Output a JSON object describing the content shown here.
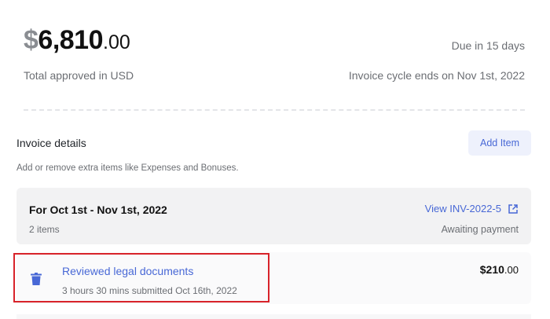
{
  "summary": {
    "currency_symbol": "$",
    "amount_main": "6,810",
    "amount_cents": ".00",
    "due": "Due in 15 days",
    "total_label": "Total approved in USD",
    "cycle": "Invoice cycle ends on Nov 1st, 2022"
  },
  "details": {
    "title": "Invoice details",
    "add_button": "Add Item",
    "hint": "Add or remove extra items like Expenses and Bonuses."
  },
  "period": {
    "title": "For Oct 1st - Nov 1st, 2022",
    "link": "View INV-2022-5",
    "items_count": "2 items",
    "status": "Awaiting payment"
  },
  "item": {
    "name": "Reviewed legal documents",
    "meta": "3 hours 30 mins submitted Oct 16th, 2022",
    "amount_main": "$210",
    "amount_cents": ".00",
    "icon": "trash-icon"
  },
  "colors": {
    "accent": "#4868d6",
    "highlight": "#d8232a"
  }
}
